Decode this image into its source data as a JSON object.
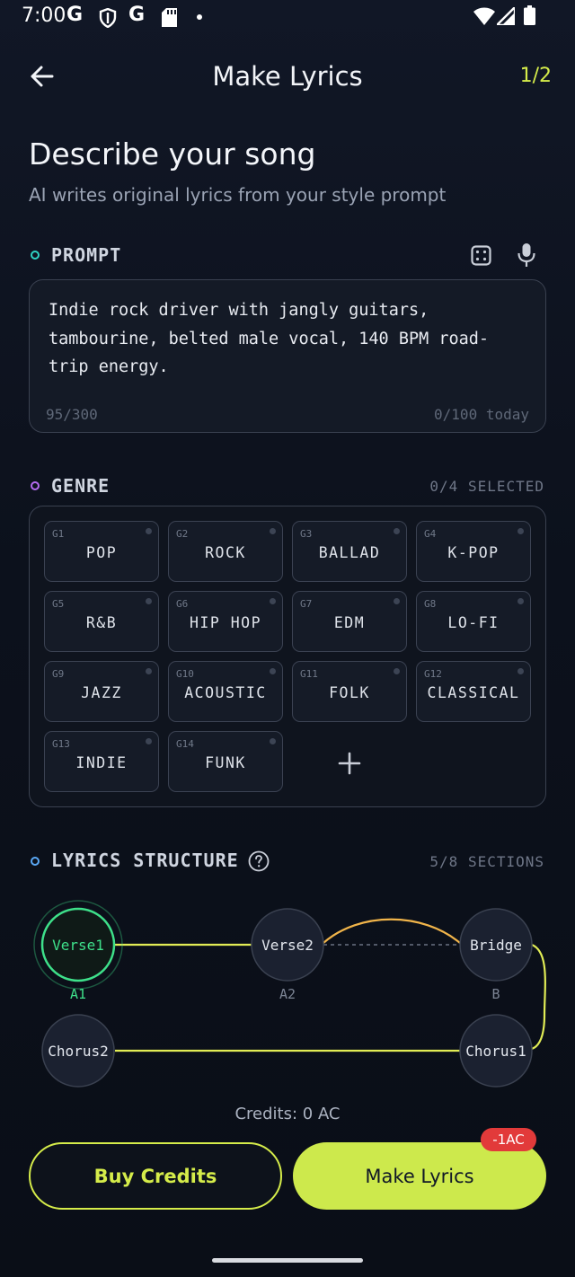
{
  "status_bar": {
    "time": "7:00",
    "icons": [
      "g-icon",
      "shield-icon",
      "g-icon",
      "sd-card-icon",
      "dot",
      "wifi-icon",
      "signal-icon",
      "battery-icon"
    ]
  },
  "header": {
    "title": "Make Lyrics",
    "step": "1/2",
    "back_icon": "arrow-left-icon"
  },
  "hero": {
    "title": "Describe your song",
    "subtitle": "AI writes original lyrics from your style prompt"
  },
  "prompt": {
    "label": "PROMPT",
    "text": "Indie rock driver with jangly guitars, tambourine, belted male vocal, 140 BPM road-trip energy.",
    "count": "95/300",
    "daily": "0/100 today",
    "icons": [
      "dice-icon",
      "mic-icon"
    ]
  },
  "genre": {
    "label": "GENRE",
    "meta": "0/4 SELECTED",
    "items": [
      {
        "code": "G1",
        "label": "POP"
      },
      {
        "code": "G2",
        "label": "ROCK"
      },
      {
        "code": "G3",
        "label": "BALLAD"
      },
      {
        "code": "G4",
        "label": "K-POP"
      },
      {
        "code": "G5",
        "label": "R&B"
      },
      {
        "code": "G6",
        "label": "HIP HOP"
      },
      {
        "code": "G7",
        "label": "EDM"
      },
      {
        "code": "G8",
        "label": "LO-FI"
      },
      {
        "code": "G9",
        "label": "JAZZ"
      },
      {
        "code": "G10",
        "label": "ACOUSTIC"
      },
      {
        "code": "G11",
        "label": "FOLK"
      },
      {
        "code": "G12",
        "label": "CLASSICAL"
      },
      {
        "code": "G13",
        "label": "INDIE"
      },
      {
        "code": "G14",
        "label": "FUNK"
      }
    ],
    "add_icon": "plus-icon"
  },
  "structure": {
    "label": "LYRICS STRUCTURE",
    "meta": "5/8 SECTIONS",
    "nodes": [
      {
        "name": "Verse1",
        "tag": "A1",
        "active": true
      },
      {
        "name": "Verse2",
        "tag": "A2",
        "active": false
      },
      {
        "name": "Bridge",
        "tag": "B",
        "active": false
      },
      {
        "name": "Chorus1",
        "tag": "",
        "active": false
      },
      {
        "name": "Chorus2",
        "tag": "",
        "active": false
      }
    ]
  },
  "credits": {
    "label": "Credits: 0 AC"
  },
  "actions": {
    "buy_label": "Buy Credits",
    "make_label": "Make Lyrics",
    "cost_badge": "-1AC"
  },
  "colors": {
    "accent": "#cde94c",
    "active_node": "#3ee08a",
    "badge": "#e23a3a",
    "prompt_dot": "#2fd3c4",
    "genre_dot": "#b46bf0",
    "structure_dot": "#5aa8f5"
  }
}
